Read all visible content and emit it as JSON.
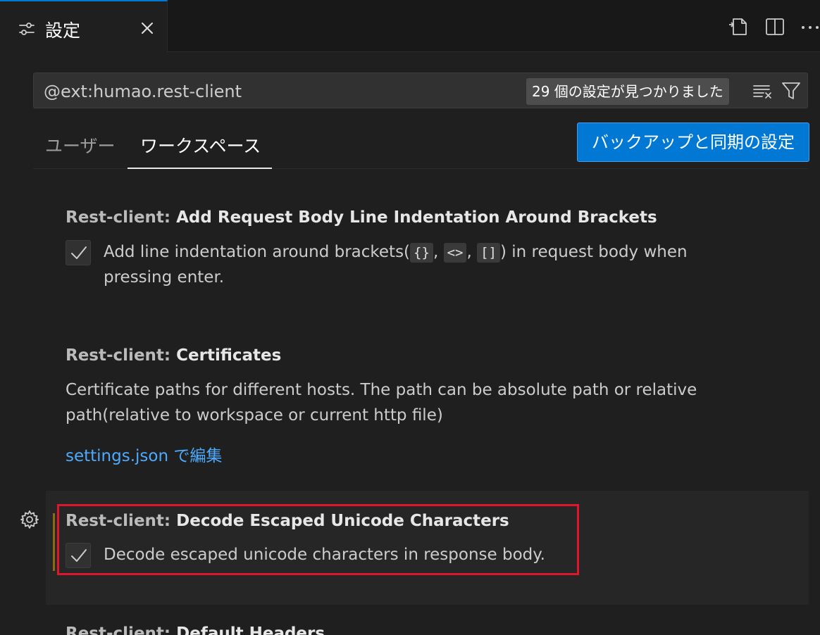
{
  "tab": {
    "title": "設定",
    "icon": "settings-sliders-icon"
  },
  "actions": [
    "open-settings-json-icon",
    "split-editor-icon",
    "more-actions-icon"
  ],
  "search": {
    "value": "@ext:humao.rest-client",
    "count": "29 個の設定が見つかりました"
  },
  "scope": {
    "tabs": [
      "ユーザー",
      "ワークスペース"
    ],
    "active": "ワークスペース",
    "backup_button": "バックアップと同期の設定"
  },
  "settings": [
    {
      "category": "Rest-client: ",
      "title": "Add Request Body Line Indentation Around Brackets",
      "desc_before": "Add line indentation around brackets(",
      "code1": "{}",
      "sep1": ", ",
      "code2": "<>",
      "sep2": ", ",
      "code3": "[]",
      "desc_after": ") in request body when pressing enter.",
      "checked": true
    },
    {
      "category": "Rest-client: ",
      "title": "Certificates",
      "description": "Certificate paths for different hosts. The path can be absolute path or relative path(relative to workspace or current http file)",
      "link": "settings.json で編集"
    },
    {
      "category": "Rest-client: ",
      "title": "Decode Escaped Unicode Characters",
      "description": "Decode escaped unicode characters in response body.",
      "checked": true
    },
    {
      "category": "Rest-client: ",
      "title": "Default Headers"
    }
  ],
  "colors": {
    "accent": "#0078d4",
    "link": "#4daafc",
    "modified": "#8c6a14",
    "highlight": "#e0162c"
  }
}
